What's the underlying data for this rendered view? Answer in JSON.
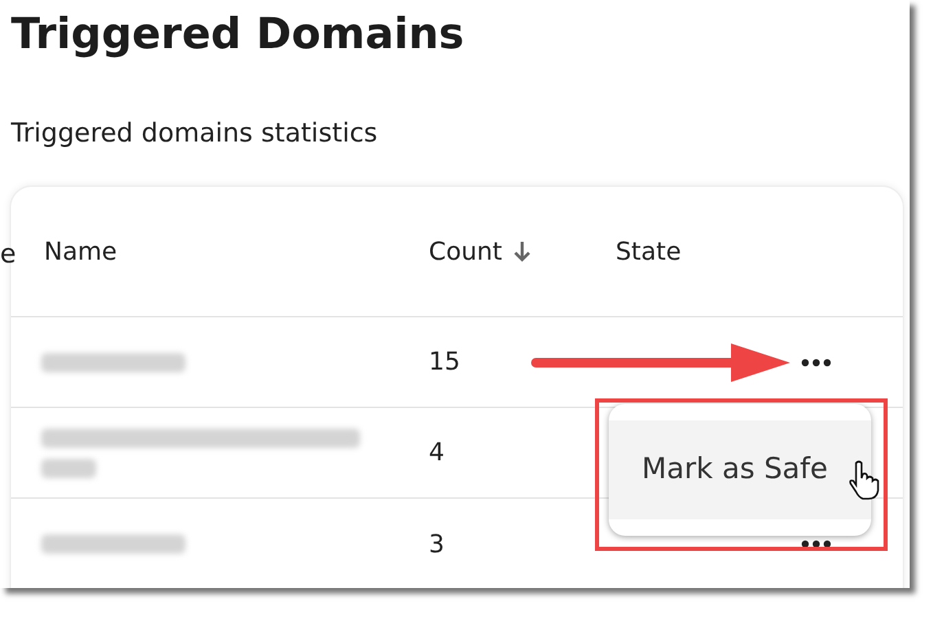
{
  "title": "Triggered Domains",
  "subtitle": "Triggered domains statistics",
  "background_fragment": "e",
  "table": {
    "columns": [
      {
        "label": "Name",
        "sorted": false
      },
      {
        "label": "Count",
        "sorted": true
      },
      {
        "label": "State",
        "sorted": false
      }
    ],
    "rows": [
      {
        "kind": "blurred",
        "count": "15",
        "actions_visible": true
      },
      {
        "kind": "blurred_two_line",
        "count": "4",
        "actions_visible": false
      },
      {
        "kind": "blurred",
        "count": "3",
        "actions_visible": true
      }
    ]
  },
  "menu": {
    "items": [
      {
        "label": "Mark as Safe",
        "selected": true
      }
    ]
  },
  "annotation": {
    "arrow": true,
    "highlight_box": true
  }
}
